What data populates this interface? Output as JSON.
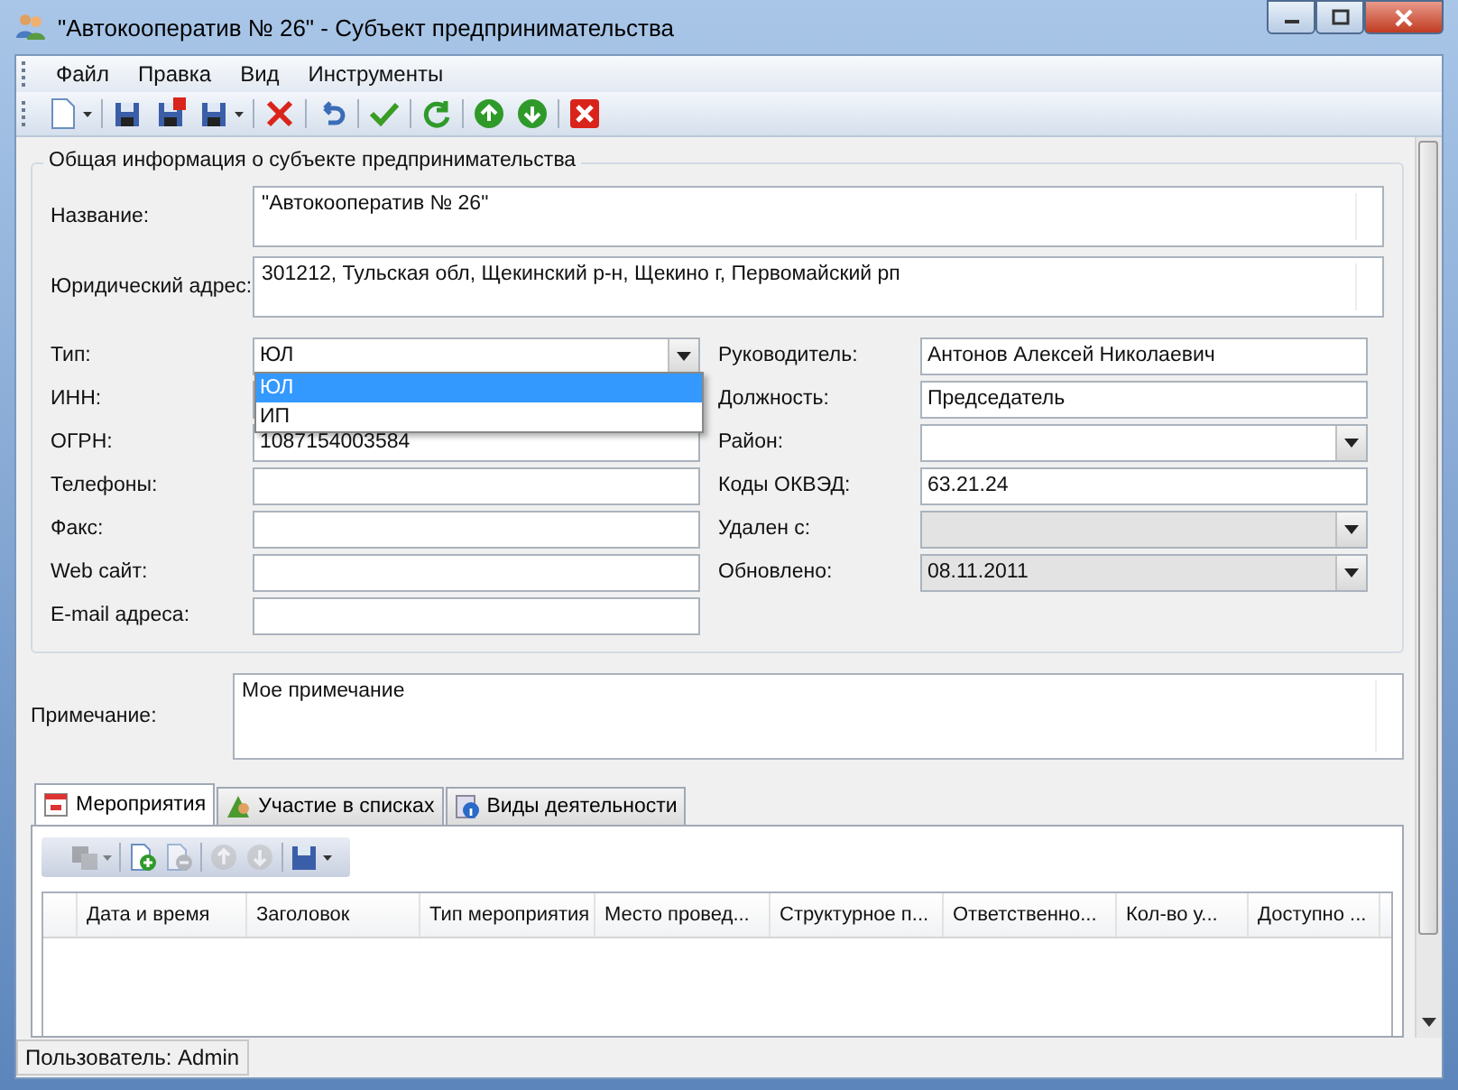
{
  "window": {
    "title": "\"Автокооператив № 26\" - Субъект предпринимательства"
  },
  "menu": [
    "Файл",
    "Правка",
    "Вид",
    "Инструменты"
  ],
  "toolbar": [
    {
      "kind": "new",
      "dropdown": true
    },
    {
      "kind": "sep"
    },
    {
      "kind": "save"
    },
    {
      "kind": "save-close"
    },
    {
      "kind": "save-copy",
      "dropdown": true
    },
    {
      "kind": "sep"
    },
    {
      "kind": "delete"
    },
    {
      "kind": "sep"
    },
    {
      "kind": "undo"
    },
    {
      "kind": "sep"
    },
    {
      "kind": "check"
    },
    {
      "kind": "sep"
    },
    {
      "kind": "refresh"
    },
    {
      "kind": "sep"
    },
    {
      "kind": "up"
    },
    {
      "kind": "down"
    },
    {
      "kind": "sep"
    },
    {
      "kind": "close"
    }
  ],
  "group": {
    "title": "Общая информация о субъекте предпринимательства",
    "name": {
      "label": "Название:",
      "value": "\"Автокооператив № 26\""
    },
    "address": {
      "label": "Юридический адрес:",
      "value": "301212, Тульская обл, Щекинский р-н, Щекино г, Первомайский рп"
    },
    "left_fields": [
      {
        "label": "Тип:",
        "value": "ЮЛ",
        "kind": "combo",
        "disabled": false
      },
      {
        "label": "ИНН:",
        "kind": "text"
      },
      {
        "label": "ОГРН:",
        "value": "1087154003584",
        "kind": "text",
        "disabled": false
      },
      {
        "label": "Телефоны:",
        "kind": "text",
        "disabled": false
      },
      {
        "label": "Факс:",
        "kind": "text",
        "disabled": false
      },
      {
        "label": "Web сайт:",
        "kind": "text",
        "disabled": false
      },
      {
        "label": "E-mail адреса:",
        "kind": "text",
        "disabled": false
      }
    ],
    "right_fields": [
      {
        "label": "Руководитель:",
        "value": "Антонов Алексей Николаевич",
        "kind": "text",
        "disabled": false
      },
      {
        "label": "Должность:",
        "value": "Председатель",
        "kind": "text",
        "disabled": false
      },
      {
        "label": "Район:",
        "kind": "combo",
        "disabled": false
      },
      {
        "label": "Коды ОКВЭД:",
        "value": "63.21.24",
        "kind": "text",
        "disabled": false
      },
      {
        "label": "Удален с:",
        "kind": "combo",
        "disabled": true
      },
      {
        "label": "Обновлено:",
        "value": "08.11.2011",
        "kind": "combo",
        "disabled": true
      }
    ],
    "dropdown": {
      "options": [
        {
          "label": "ЮЛ",
          "selected": true
        },
        {
          "label": "ИП",
          "selected": false
        }
      ]
    }
  },
  "note": {
    "label": "Примечание:",
    "value": "Мое примечание"
  },
  "tabs": [
    {
      "label": "Мероприятия",
      "kind": "calendar",
      "selected": true
    },
    {
      "label": "Участие в списках",
      "kind": "people",
      "selected": false
    },
    {
      "label": "Виды деятельности",
      "kind": "info",
      "selected": false
    }
  ],
  "subtoolbar": [
    {
      "kind": "copy",
      "disabled": true,
      "dropdown": true
    },
    {
      "kind": "sep"
    },
    {
      "kind": "add",
      "disabled": false,
      "dropdown": false
    },
    {
      "kind": "remove",
      "disabled": true,
      "dropdown": false
    },
    {
      "kind": "sep"
    },
    {
      "kind": "up",
      "disabled": true,
      "dropdown": false
    },
    {
      "kind": "down",
      "disabled": true,
      "dropdown": false
    },
    {
      "kind": "sep"
    },
    {
      "kind": "save",
      "disabled": false,
      "dropdown": true
    }
  ],
  "grid": {
    "columns": [
      "Дата и время",
      "Заголовок",
      "Тип мероприятия",
      "Место провед...",
      "Структурное п...",
      "Ответственно...",
      "Кол-во у...",
      "Доступно ..."
    ]
  },
  "status_bar": "Пользователь: Admin"
}
